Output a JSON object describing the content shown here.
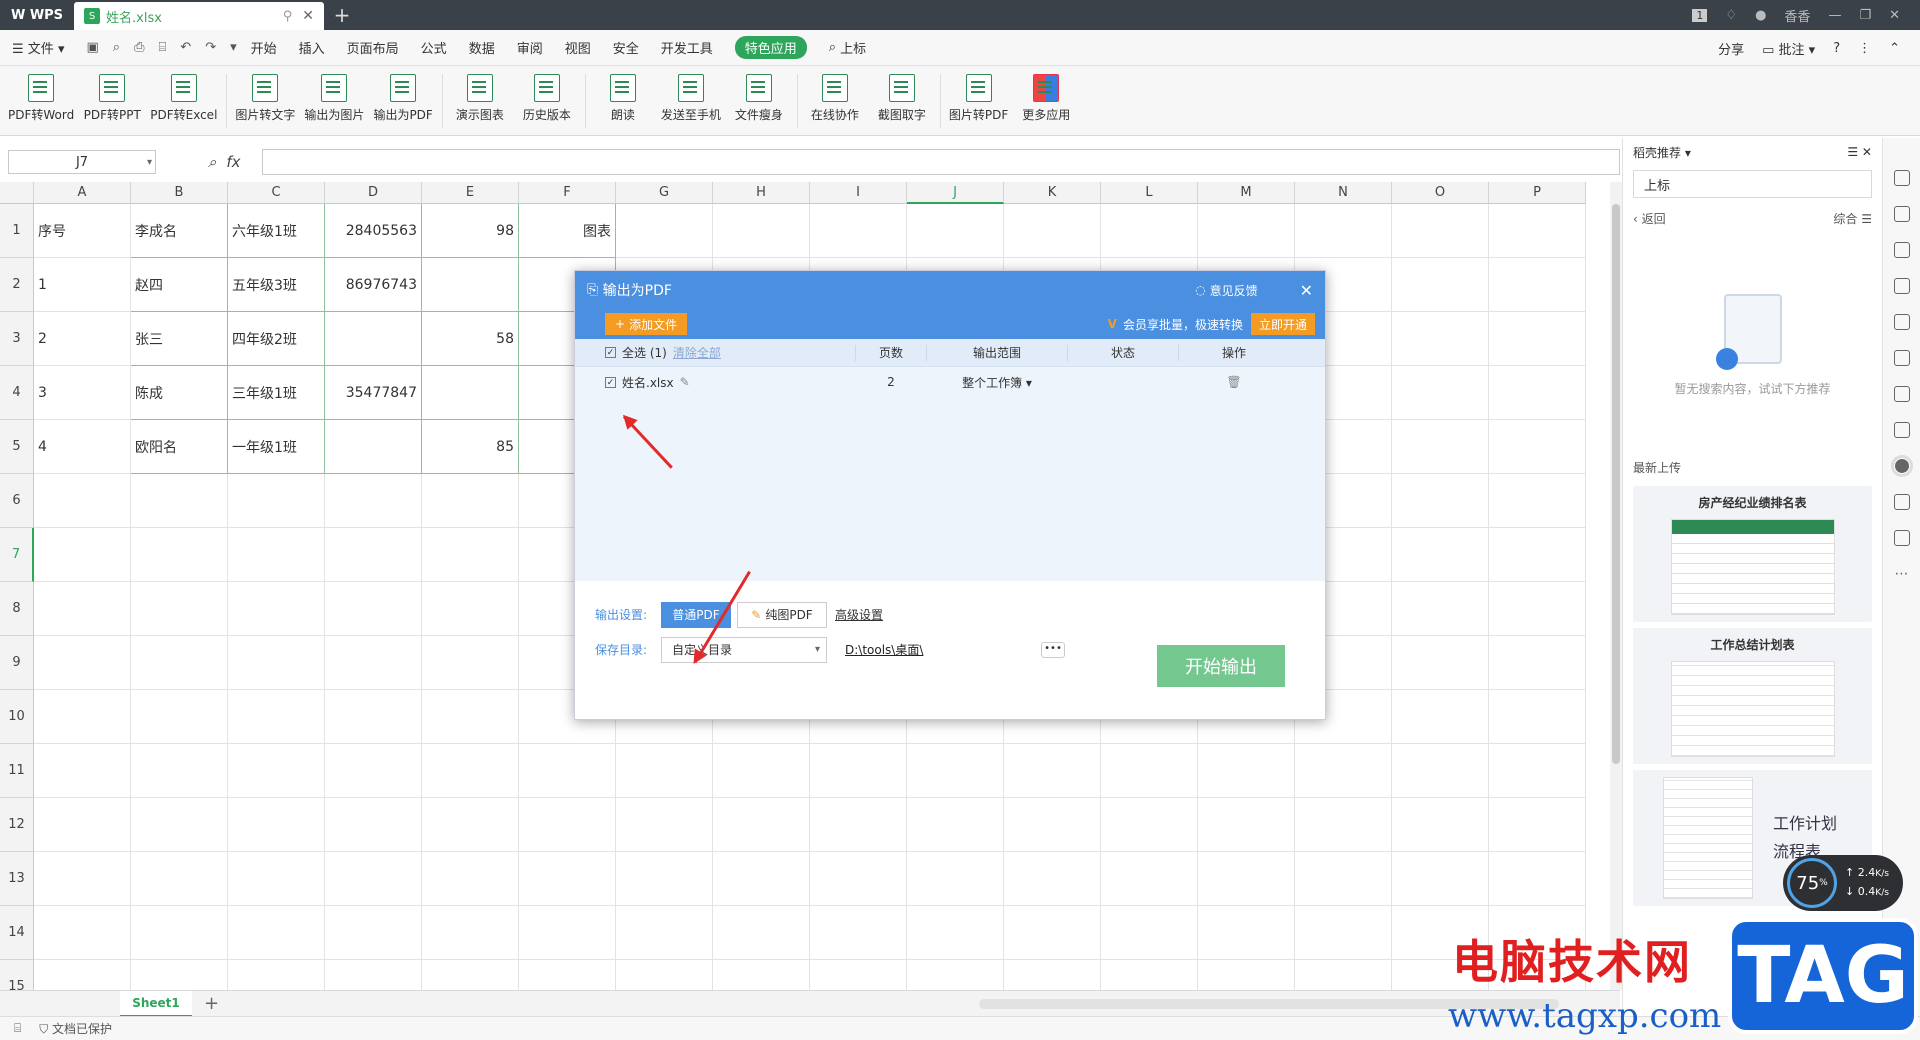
{
  "titlebar": {
    "app": "WPS",
    "doc_tab": "姓名.xlsx",
    "tab_badge": "1",
    "user": "香香"
  },
  "menu": {
    "items": [
      "文件",
      "开始",
      "插入",
      "页面布局",
      "公式",
      "数据",
      "审阅",
      "视图",
      "安全",
      "开发工具",
      "特色应用"
    ],
    "active": "特色应用",
    "search": "上标",
    "right": [
      "分享",
      "批注"
    ]
  },
  "toolbar": {
    "tools": [
      "PDF转Word",
      "PDF转PPT",
      "PDF转Excel",
      "图片转文字",
      "输出为图片",
      "输出为PDF",
      "演示图表",
      "历史版本",
      "朗读",
      "发送至手机",
      "文件瘦身",
      "在线协作",
      "截图取字",
      "图片转PDF",
      "更多应用"
    ]
  },
  "formula": {
    "cell_ref": "J7",
    "fx": "fx"
  },
  "sheet": {
    "columns": [
      "A",
      "B",
      "C",
      "D",
      "E",
      "F",
      "G",
      "H",
      "I",
      "J",
      "K",
      "L",
      "M",
      "N",
      "O",
      "P"
    ],
    "rows": [
      "1",
      "2",
      "3",
      "4",
      "5",
      "6",
      "7",
      "8",
      "9",
      "10",
      "11",
      "12",
      "13",
      "14",
      "15"
    ],
    "data": [
      [
        "序号",
        "李成名",
        "六年级1班",
        "28405563",
        "98",
        "图表"
      ],
      [
        "1",
        "赵四",
        "五年级3班",
        "86976743",
        "",
        ""
      ],
      [
        "2",
        "张三",
        "四年级2班",
        "",
        "58",
        ""
      ],
      [
        "3",
        "陈成",
        "三年级1班",
        "35477847",
        "",
        ""
      ],
      [
        "4",
        "欧阳名",
        "一年级1班",
        "",
        "85",
        ""
      ]
    ],
    "tab": "Sheet1"
  },
  "status": {
    "protect": "文档已保护"
  },
  "dialog": {
    "title": "输出为PDF",
    "feedback": "意见反馈",
    "add_file": "添加文件",
    "vip_text": "会员享批量，极速转换",
    "vip_btn": "立即开通",
    "select_all": "全选 (1)",
    "clear_all": "清除全部",
    "headers": [
      "页数",
      "输出范围",
      "状态",
      "操作"
    ],
    "file": {
      "name": "姓名.xlsx",
      "pages": "2",
      "range": "整个工作簿"
    },
    "output_label": "输出设置:",
    "normal_pdf": "普通PDF",
    "pure_pdf": "纯图PDF",
    "advanced": "高级设置",
    "save_label": "保存目录:",
    "save_select": "自定义目录",
    "path": "D:\\tools\\桌面\\",
    "start": "开始输出"
  },
  "right_panel": {
    "title": "稻壳推荐",
    "search": "上标",
    "back": "返回",
    "sort": "综合",
    "empty": "暂无搜索内容，试试下方推荐",
    "section": "最新上传",
    "cards": [
      "房产经纪业绩排名表",
      "工作总结计划表"
    ],
    "card3_title": [
      "工作计划",
      "流程表"
    ]
  },
  "net": {
    "percent": "75",
    "up": "2.4",
    "down": "0.4",
    "unit": "K/s"
  },
  "watermark": {
    "text": "电脑技术网",
    "url": "www.tagxp.com",
    "tag": "TAG"
  }
}
